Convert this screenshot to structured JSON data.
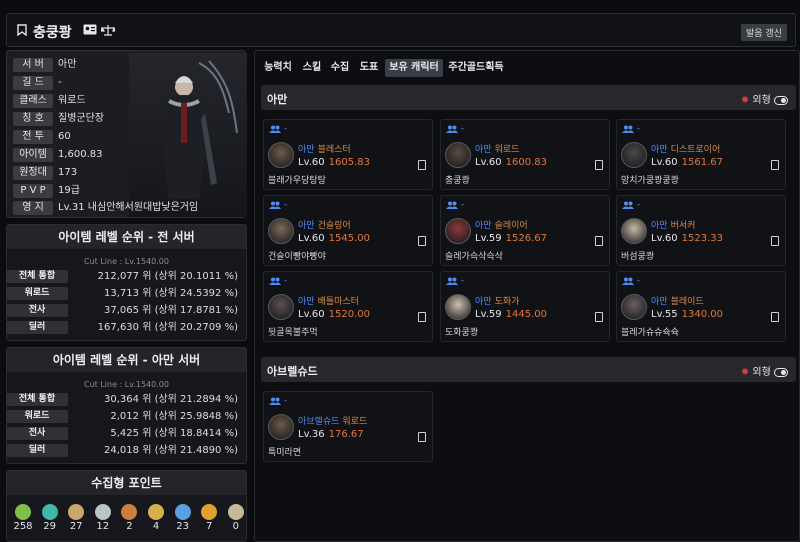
{
  "header": {
    "name": "충쿵쾅",
    "refresh_label": "발음 갱신"
  },
  "profile": {
    "rows": [
      {
        "label": "서 버",
        "value": "아만"
      },
      {
        "label": "길 드",
        "value": "-"
      },
      {
        "label": "클래스",
        "value": "워로드"
      },
      {
        "label": "칭 호",
        "value": "질병군단장"
      },
      {
        "label": "전 투",
        "value": "60"
      },
      {
        "label": "아이템",
        "value": "1,600.83"
      },
      {
        "label": "원정대",
        "value": "173"
      },
      {
        "label": "P V P",
        "value": "19급"
      },
      {
        "label": "영 지",
        "value": "Lv.31 내심안해서원대밥낮은거임"
      }
    ]
  },
  "rank_all": {
    "title": "아이템 레벨 순위 - 전 서버",
    "cutline": "Cut Line : Lv.1540.00",
    "rows": [
      {
        "label": "전체 통합",
        "value": "212,077 위 (상위 20.1011 %)"
      },
      {
        "label": "워로드",
        "value": "13,713 위 (상위 24.5392 %)"
      },
      {
        "label": "전사",
        "value": "37,065 위 (상위 17.8781 %)"
      },
      {
        "label": "딜러",
        "value": "167,630 위 (상위 20.2709 %)"
      }
    ]
  },
  "rank_server": {
    "title": "아이템 레벨 순위 - 아만 서버",
    "cutline": "Cut Line : Lv.1540.00",
    "rows": [
      {
        "label": "전체 통합",
        "value": "30,364 위 (상위 21.2894 %)"
      },
      {
        "label": "워로드",
        "value": "2,012 위 (상위 25.9848 %)"
      },
      {
        "label": "전사",
        "value": "5,425 위 (상위 18.8414 %)"
      },
      {
        "label": "딜러",
        "value": "24,018 위 (상위 21.4890 %)"
      }
    ]
  },
  "collect": {
    "title": "수집형 포인트",
    "items": [
      {
        "icon": "mokoko-seed-icon",
        "count": "258",
        "color": "#7fbf4a"
      },
      {
        "icon": "island-soul-icon",
        "count": "29",
        "color": "#3fb8a8"
      },
      {
        "icon": "treasure-map-icon",
        "count": "27",
        "color": "#c9a66b"
      },
      {
        "icon": "giant-heart-icon",
        "count": "12",
        "color": "#b8c4c8"
      },
      {
        "icon": "ignea-token-icon",
        "count": "2",
        "color": "#c8803a"
      },
      {
        "icon": "orpheus-star-icon",
        "count": "4",
        "color": "#d6b04a"
      },
      {
        "icon": "world-tree-leaf-icon",
        "count": "23",
        "color": "#5aa0e0"
      },
      {
        "icon": "sea-bounty-icon",
        "count": "7",
        "color": "#e0a030"
      },
      {
        "icon": "masterpiece-icon",
        "count": "0",
        "color": "#c8b89a"
      }
    ]
  },
  "tabs": [
    "능력치",
    "스킬",
    "수집",
    "도표",
    "보유 캐릭터",
    "주간골드획득"
  ],
  "active_tab": "보유 캐릭터",
  "sections": [
    {
      "title": "아만",
      "toggle_label": "외형",
      "chars": [
        {
          "guild": "-",
          "server": "아만",
          "class": "블레스터",
          "level": "Lv.60",
          "ilvl": "1605.83",
          "name": "블래가우당탕탕"
        },
        {
          "guild": "-",
          "server": "아만",
          "class": "워로드",
          "level": "Lv.60",
          "ilvl": "1600.83",
          "name": "충쿵쾅"
        },
        {
          "guild": "-",
          "server": "아만",
          "class": "디스트로이어",
          "level": "Lv.60",
          "ilvl": "1561.67",
          "name": "망치가쿵쾅쿵쾅"
        },
        {
          "guild": "-",
          "server": "아만",
          "class": "건슬링어",
          "level": "Lv.60",
          "ilvl": "1545.00",
          "name": "건슬이빵야빵야"
        },
        {
          "guild": "-",
          "server": "아만",
          "class": "슬레이어",
          "level": "Lv.59",
          "ilvl": "1526.67",
          "name": "슬레가슥삭슥삭"
        },
        {
          "guild": "-",
          "server": "아만",
          "class": "버서커",
          "level": "Lv.60",
          "ilvl": "1523.33",
          "name": "버섬쿵쾅"
        },
        {
          "guild": "-",
          "server": "아만",
          "class": "배틀마스터",
          "level": "Lv.60",
          "ilvl": "1520.00",
          "name": "뒷골목불주먹"
        },
        {
          "guild": "-",
          "server": "아만",
          "class": "도화가",
          "level": "Lv.59",
          "ilvl": "1445.00",
          "name": "도화쿵쾅"
        },
        {
          "guild": "-",
          "server": "아만",
          "class": "블레이드",
          "level": "Lv.55",
          "ilvl": "1340.00",
          "name": "블레가슈슈슉슉"
        }
      ]
    },
    {
      "title": "아브렐슈드",
      "toggle_label": "외형",
      "chars": [
        {
          "guild": "-",
          "server": "아브렐슈드",
          "class": "워로드",
          "level": "Lv.36",
          "ilvl": "176.67",
          "name": "특미라면"
        }
      ]
    }
  ],
  "colors": {
    "accent_blue": "#4f8cf5",
    "ilvl_orange": "#e0783c",
    "class_orange": "#d98a4a"
  }
}
